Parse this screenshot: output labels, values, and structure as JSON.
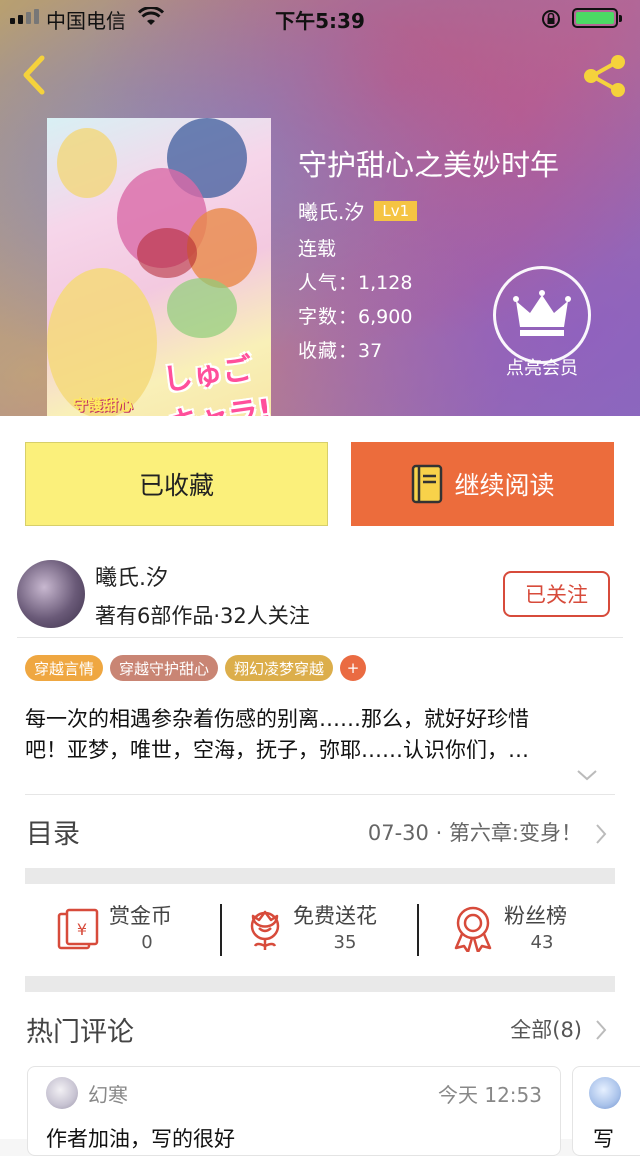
{
  "status_bar": {
    "carrier": "中国电信",
    "time": "下午5:39"
  },
  "book": {
    "title": "守护甜心之美妙时年",
    "author": "曦氏.汐",
    "level": "Lv1",
    "status": "连载",
    "popularity_label": "人气：",
    "popularity": "1,128",
    "words_label": "字数：",
    "words": "6,900",
    "favorites_label": "收藏：",
    "favorites": "37",
    "vip_label": "点亮会员",
    "cover_logo": "しゅごキャラ!",
    "cover_sub": "守護甜心"
  },
  "actions": {
    "favorited": "已收藏",
    "continue_reading": "继续阅读"
  },
  "author_card": {
    "name": "曦氏.汐",
    "info": "著有6部作品·32人关注",
    "follow_label": "已关注"
  },
  "tags": [
    {
      "label": "穿越言情",
      "color": "#efa741"
    },
    {
      "label": "穿越守护甜心",
      "color": "#c98574"
    },
    {
      "label": "翔幻凌梦穿越",
      "color": "#dcae4b"
    },
    {
      "label": "+",
      "color": "#ea6b42"
    }
  ],
  "description": {
    "line1": "每一次的相遇参杂着伤感的别离……那么，就好好珍惜",
    "line2": "吧！亚梦，唯世，空海，抚子，弥耶……认识你们，…"
  },
  "toc": {
    "label": "目录",
    "latest": "07-30 · 第六章:变身！"
  },
  "stats": [
    {
      "title": "赏金币",
      "value": "0",
      "icon": "red-envelope-icon"
    },
    {
      "title": "免费送花",
      "value": "35",
      "icon": "flower-icon"
    },
    {
      "title": "粉丝榜",
      "value": "43",
      "icon": "ribbon-medal-icon"
    }
  ],
  "comments": {
    "label": "热门评论",
    "all": "全部(8)",
    "items": [
      {
        "user": "幻寒",
        "time": "今天 12:53",
        "text": "作者加油，写的很好"
      },
      {
        "text": "写"
      }
    ]
  },
  "colors": {
    "favorite_button": "#fbf07b",
    "read_button": "#ec6c3c",
    "accent_red": "#d74b3b",
    "level_badge": "#f5c443"
  }
}
